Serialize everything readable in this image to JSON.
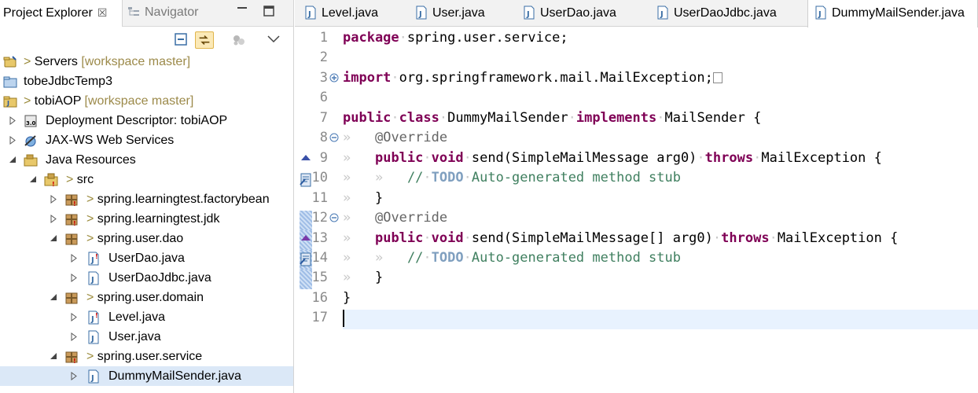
{
  "left_panel": {
    "tabs": {
      "project_explorer": "Project Explorer",
      "close_symbol": "☒",
      "navigator": "Navigator"
    },
    "tree": [
      {
        "label": "Servers",
        "decoration": "> ",
        "repo": "[workspace master]",
        "icon": "server-project-icon"
      },
      {
        "label": "tobeJdbcTemp3",
        "decoration": "",
        "repo": "",
        "icon": "folder-icon"
      },
      {
        "label": "tobiAOP",
        "decoration": "> ",
        "repo": "[workspace master]",
        "icon": "java-project-icon"
      },
      {
        "label": "Deployment Descriptor: tobiAOP",
        "decoration": "",
        "repo": "",
        "icon": "deployment-descriptor-icon"
      },
      {
        "label": "JAX-WS Web Services",
        "decoration": "",
        "repo": "",
        "icon": "web-services-icon"
      },
      {
        "label": "Java Resources",
        "decoration": "",
        "repo": "",
        "icon": "java-resources-icon"
      },
      {
        "label": "src",
        "decoration": "> ",
        "repo": "",
        "icon": "source-folder-icon"
      },
      {
        "label": "spring.learningtest.factorybean",
        "decoration": "> ",
        "repo": "",
        "icon": "package-icon"
      },
      {
        "label": "spring.learningtest.jdk",
        "decoration": "> ",
        "repo": "",
        "icon": "package-icon"
      },
      {
        "label": "spring.user.dao",
        "decoration": "> ",
        "repo": "",
        "icon": "package-icon"
      },
      {
        "label": "UserDao.java",
        "decoration": "",
        "repo": "",
        "icon": "java-file-icon"
      },
      {
        "label": "UserDaoJdbc.java",
        "decoration": "",
        "repo": "",
        "icon": "java-file-icon"
      },
      {
        "label": "spring.user.domain",
        "decoration": "> ",
        "repo": "",
        "icon": "package-icon"
      },
      {
        "label": "Level.java",
        "decoration": "",
        "repo": "",
        "icon": "java-file-icon"
      },
      {
        "label": "User.java",
        "decoration": "",
        "repo": "",
        "icon": "java-file-icon"
      },
      {
        "label": "spring.user.service",
        "decoration": "> ",
        "repo": "",
        "icon": "package-icon"
      },
      {
        "label": "DummyMailSender.java",
        "decoration": "",
        "repo": "",
        "icon": "java-file-icon"
      }
    ]
  },
  "editor": {
    "tabs": [
      {
        "label": "Level.java"
      },
      {
        "label": "User.java"
      },
      {
        "label": "UserDao.java"
      },
      {
        "label": "UserDaoJdbc.java"
      },
      {
        "label": "DummyMailSender.java",
        "active": true
      }
    ],
    "line_numbers": [
      "1",
      "2",
      "3",
      "6",
      "7",
      "8",
      "9",
      "10",
      "11",
      "12",
      "13",
      "14",
      "15",
      "16",
      "17"
    ],
    "code": {
      "l1_kw": "package",
      "l1_rest": "spring.user.service;",
      "l3_kw": "import",
      "l3_rest": "org.springframework.mail.MailException;",
      "l7_kw1": "public",
      "l7_kw2": "class",
      "l7_name": "DummyMailSender",
      "l7_kw3": "implements",
      "l7_rest": "MailSender {",
      "l8_ann": "@Override",
      "l9_kw1": "public",
      "l9_kw2": "void",
      "l9_sig": "send(SimpleMailMessage arg0)",
      "l9_kw3": "throws",
      "l9_rest": "MailException {",
      "l10_slashes": "//",
      "l10_tag": "TODO",
      "l10_text": "Auto-generated method stub",
      "l11_text": "}",
      "l12_ann": "@Override",
      "l13_kw1": "public",
      "l13_kw2": "void",
      "l13_sig": "send(SimpleMailMessage[] arg0)",
      "l13_kw3": "throws",
      "l13_rest": "MailException {",
      "l14_slashes": "//",
      "l14_tag": "TODO",
      "l14_text": "Auto-generated method stub",
      "l15_text": "}",
      "l16_text": "}",
      "tab_marker": "»"
    }
  },
  "colors": {
    "keyword": "#7f0055",
    "annotation": "#646464",
    "comment": "#3f7f5f",
    "todo_tag": "#7f9fbf",
    "current_line": "#e8f2fe"
  }
}
